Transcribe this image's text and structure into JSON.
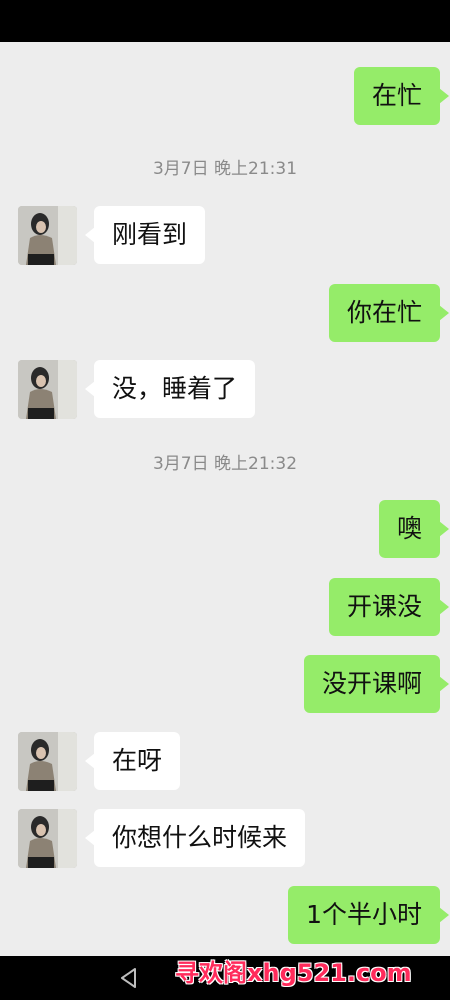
{
  "timestamps": [
    "3月7日 晚上21:31",
    "3月7日 晚上21:32"
  ],
  "messages": [
    {
      "text": "在忙",
      "dir": "out"
    },
    {
      "text": "刚看到",
      "dir": "in"
    },
    {
      "text": "你在忙",
      "dir": "out"
    },
    {
      "text": "没，睡着了",
      "dir": "in"
    },
    {
      "text": "噢",
      "dir": "out"
    },
    {
      "text": "开课没",
      "dir": "out"
    },
    {
      "text": "没开课啊",
      "dir": "out"
    },
    {
      "text": "在呀",
      "dir": "in"
    },
    {
      "text": "你想什么时候来",
      "dir": "in"
    },
    {
      "text": "1个半小时",
      "dir": "out"
    }
  ],
  "watermark": "寻欢阁xhg521.com",
  "colors": {
    "outgoing_bubble": "#95ec69",
    "incoming_bubble": "#ffffff",
    "background": "#ededed"
  }
}
